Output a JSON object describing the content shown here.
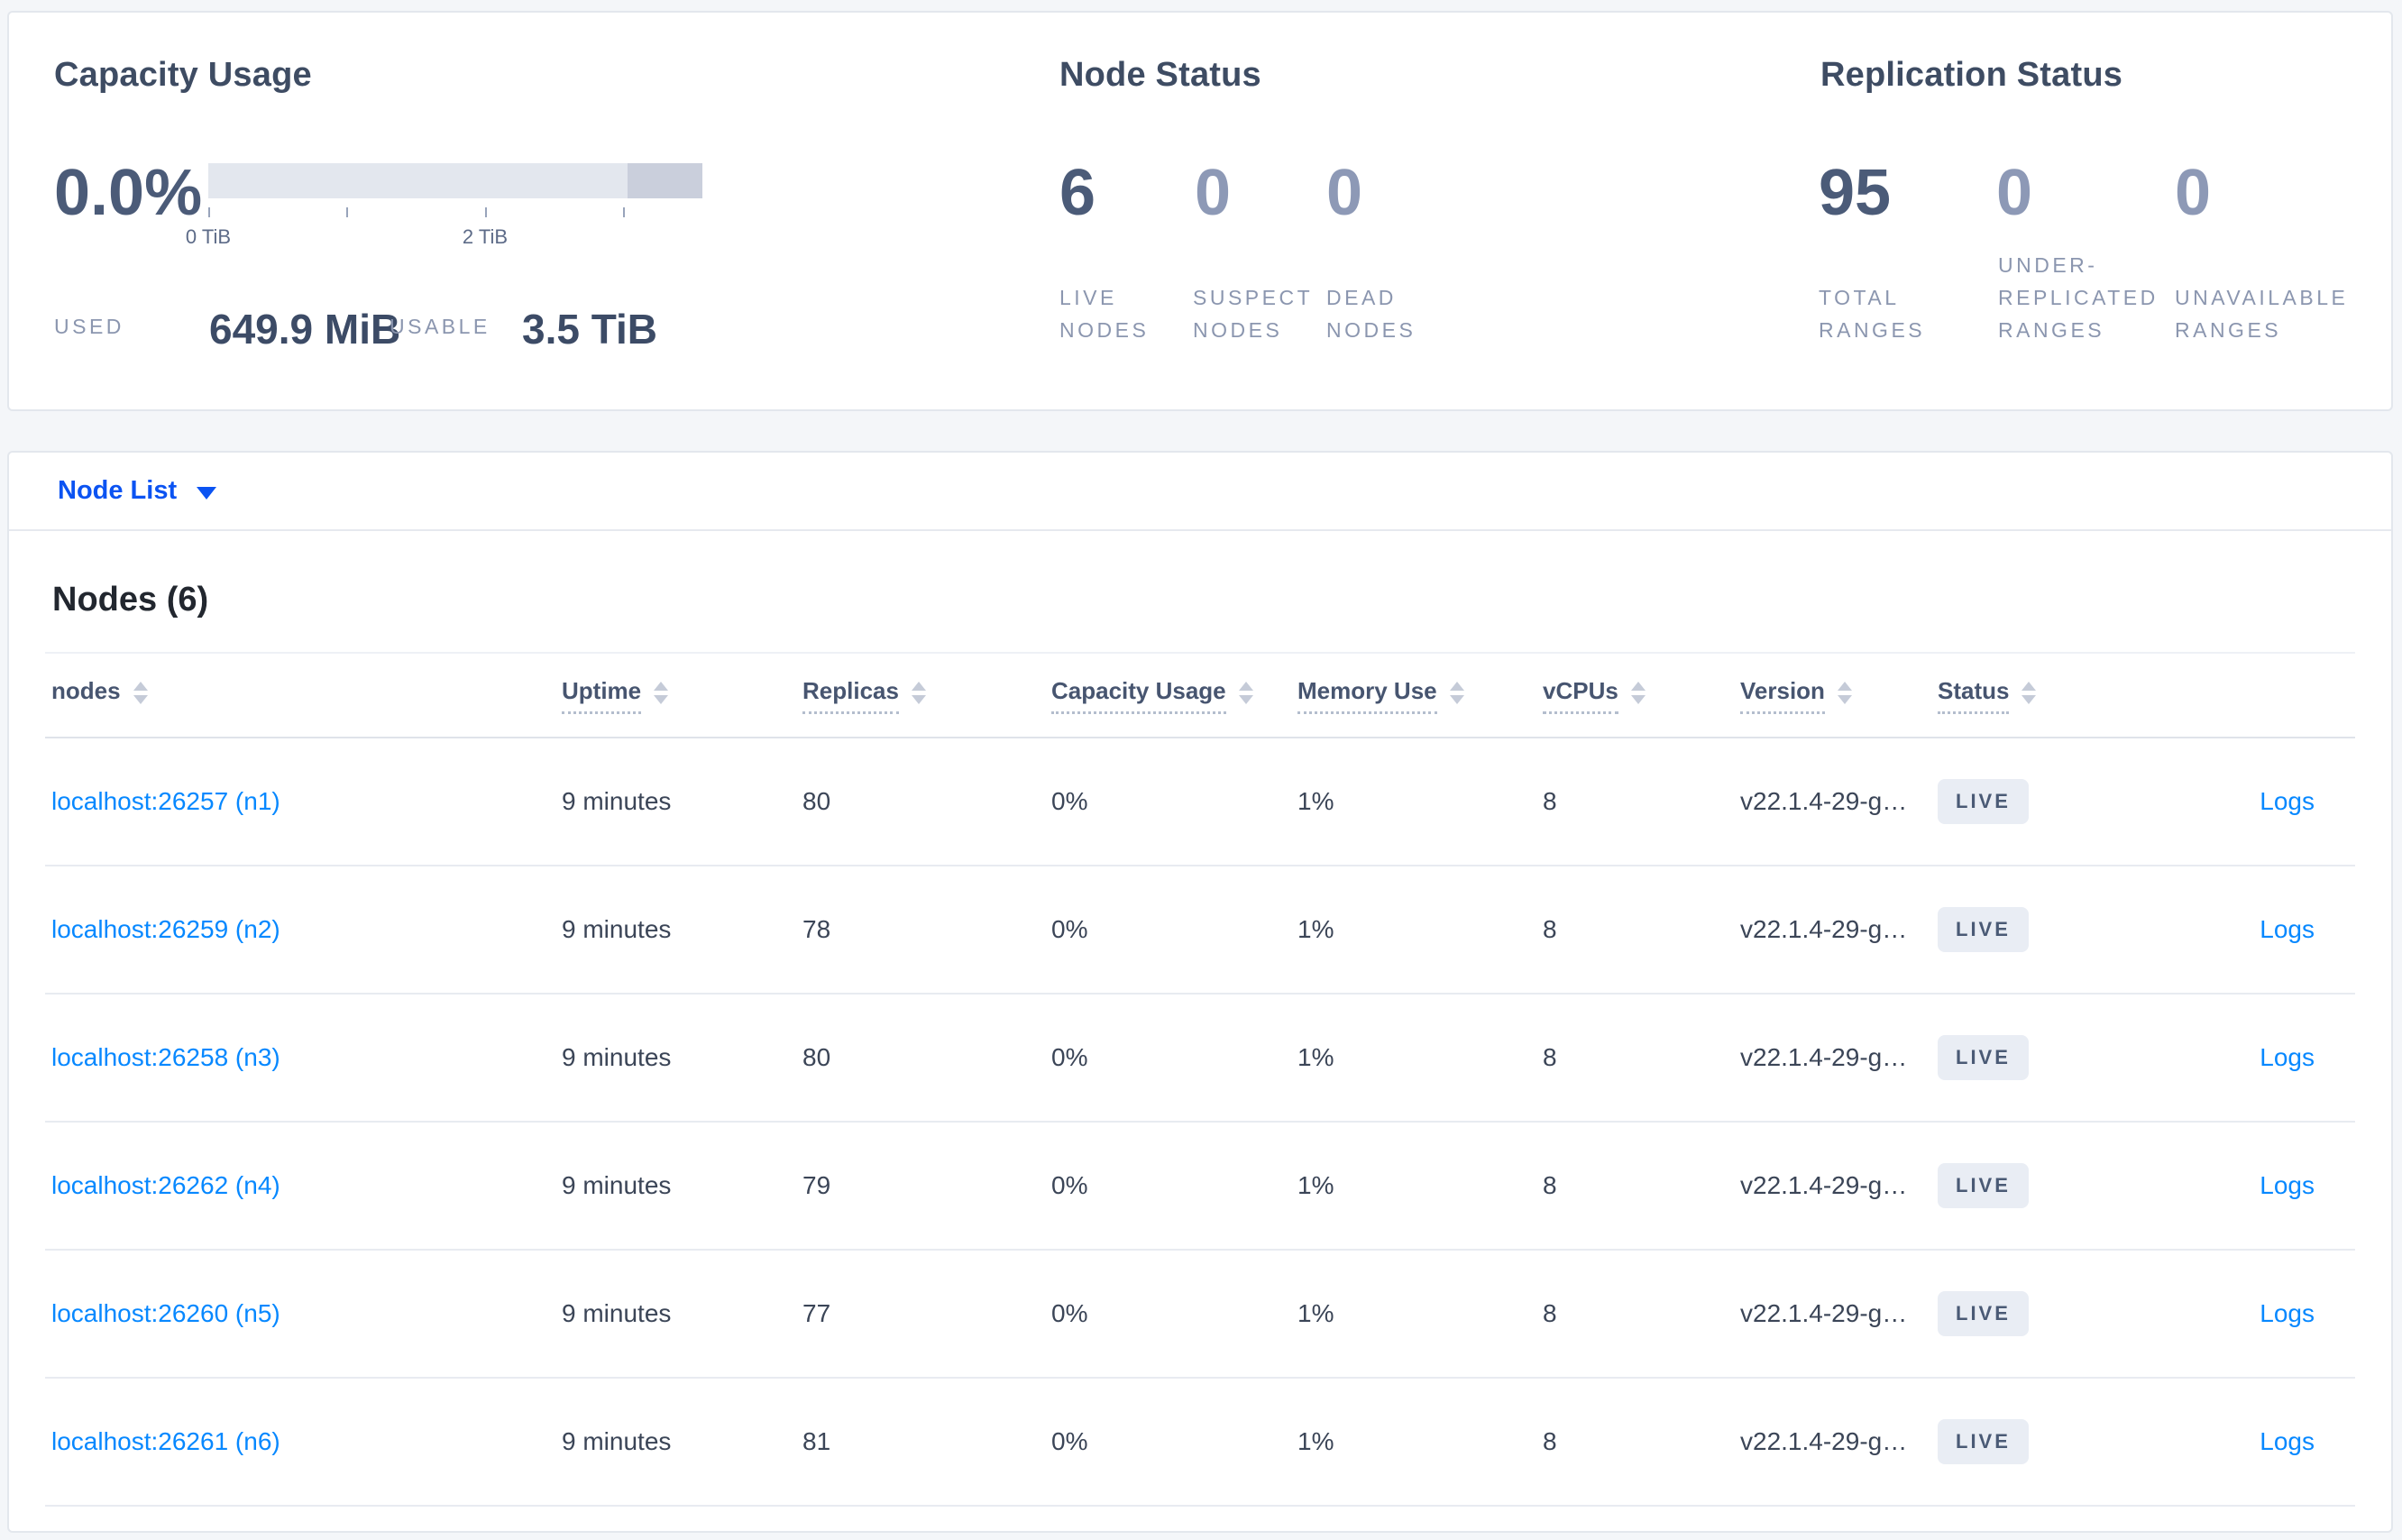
{
  "summary": {
    "capacity": {
      "title": "Capacity Usage",
      "percent": "0.0%",
      "ticks": {
        "t0": "0 TiB",
        "t2": "2 TiB"
      },
      "used_label": "USED",
      "used_value": "649.9 MiB",
      "usable_label": "USABLE",
      "usable_value": "3.5 TiB"
    },
    "node_status": {
      "title": "Node Status",
      "stats": [
        {
          "value": "6",
          "label": "LIVE NODES"
        },
        {
          "value": "0",
          "label": "SUSPECT NODES"
        },
        {
          "value": "0",
          "label": "DEAD NODES"
        }
      ]
    },
    "replication": {
      "title": "Replication Status",
      "stats": [
        {
          "value": "95",
          "label": "TOTAL RANGES"
        },
        {
          "value": "0",
          "label": "UNDER-REPLICATED RANGES"
        },
        {
          "value": "0",
          "label": "UNAVAILABLE RANGES"
        }
      ]
    }
  },
  "view_selector": {
    "label": "Node List"
  },
  "table": {
    "title": "Nodes (6)",
    "columns": {
      "nodes": "nodes",
      "uptime": "Uptime",
      "replicas": "Replicas",
      "capacity": "Capacity Usage",
      "memory": "Memory Use",
      "vcpus": "vCPUs",
      "version": "Version",
      "status": "Status"
    },
    "rows": [
      {
        "node": "localhost:26257 (n1)",
        "uptime": "9 minutes",
        "replicas": "80",
        "capacity": "0%",
        "memory": "1%",
        "vcpus": "8",
        "version": "v22.1.4-29-g…",
        "status": "LIVE",
        "logs": "Logs"
      },
      {
        "node": "localhost:26259 (n2)",
        "uptime": "9 minutes",
        "replicas": "78",
        "capacity": "0%",
        "memory": "1%",
        "vcpus": "8",
        "version": "v22.1.4-29-g…",
        "status": "LIVE",
        "logs": "Logs"
      },
      {
        "node": "localhost:26258 (n3)",
        "uptime": "9 minutes",
        "replicas": "80",
        "capacity": "0%",
        "memory": "1%",
        "vcpus": "8",
        "version": "v22.1.4-29-g…",
        "status": "LIVE",
        "logs": "Logs"
      },
      {
        "node": "localhost:26262 (n4)",
        "uptime": "9 minutes",
        "replicas": "79",
        "capacity": "0%",
        "memory": "1%",
        "vcpus": "8",
        "version": "v22.1.4-29-g…",
        "status": "LIVE",
        "logs": "Logs"
      },
      {
        "node": "localhost:26260 (n5)",
        "uptime": "9 minutes",
        "replicas": "77",
        "capacity": "0%",
        "memory": "1%",
        "vcpus": "8",
        "version": "v22.1.4-29-g…",
        "status": "LIVE",
        "logs": "Logs"
      },
      {
        "node": "localhost:26261 (n6)",
        "uptime": "9 minutes",
        "replicas": "81",
        "capacity": "0%",
        "memory": "1%",
        "vcpus": "8",
        "version": "v22.1.4-29-g…",
        "status": "LIVE",
        "logs": "Logs"
      }
    ]
  },
  "colors": {
    "page_bg": "#f4f6f9",
    "card_border": "#e3e7ed",
    "nav_blue": "#0b53f2",
    "link_blue": "#0788ff",
    "big_number": "#4b5b78",
    "big_number_muted": "#8d99b6",
    "bar_track": "#e3e7ee",
    "bar_dark_segment": "#cacfdc",
    "badge_bg": "#e9edf4",
    "badge_text": "#4a5a75"
  }
}
